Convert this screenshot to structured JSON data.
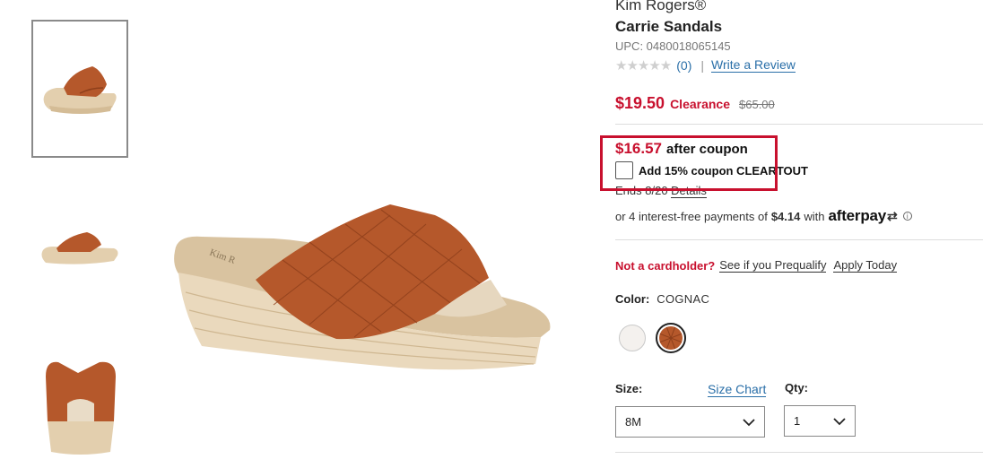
{
  "thumbnails": [
    {
      "name": "thumb-side-view",
      "selected": true
    },
    {
      "name": "thumb-side-view-alt",
      "selected": false
    },
    {
      "name": "thumb-back-view",
      "selected": false
    }
  ],
  "product": {
    "brand": "Kim Rogers®",
    "title": "Carrie Sandals",
    "upc": "UPC: 0480018065145"
  },
  "rating": {
    "stars": "★★★★★",
    "review_count": "(0)",
    "separator": "|",
    "write_review": "Write a Review"
  },
  "price": {
    "sale": "$19.50",
    "clearance_label": "Clearance",
    "original": "$65.00"
  },
  "coupon": {
    "price": "$16.57",
    "after_label": "after coupon",
    "add_label": "Add 15% coupon CLEARTOUT",
    "ends": "Ends 8/20",
    "details": "Details",
    "highlight_color": "#c8102e"
  },
  "afterpay": {
    "prefix": "or 4 interest-free payments of",
    "amount": "$4.14",
    "with": "with",
    "brand": "afterpay",
    "arrows": "⇄",
    "info": "i"
  },
  "cardholder": {
    "not_cardholder": "Not a cardholder?",
    "prequalify": "See if you Prequalify",
    "apply": "Apply Today"
  },
  "color": {
    "label": "Color:",
    "value": "COGNAC",
    "swatches": [
      {
        "name": "white",
        "hex": "#f4f1ee"
      },
      {
        "name": "cognac",
        "hex": "#b5582b",
        "selected": true
      }
    ]
  },
  "size": {
    "label": "Size:",
    "chart_link": "Size Chart",
    "value": "8M"
  },
  "qty": {
    "label": "Qty:",
    "value": "1"
  },
  "colors": {
    "accent_red": "#c8102e",
    "link_blue": "#2a6fa8"
  }
}
